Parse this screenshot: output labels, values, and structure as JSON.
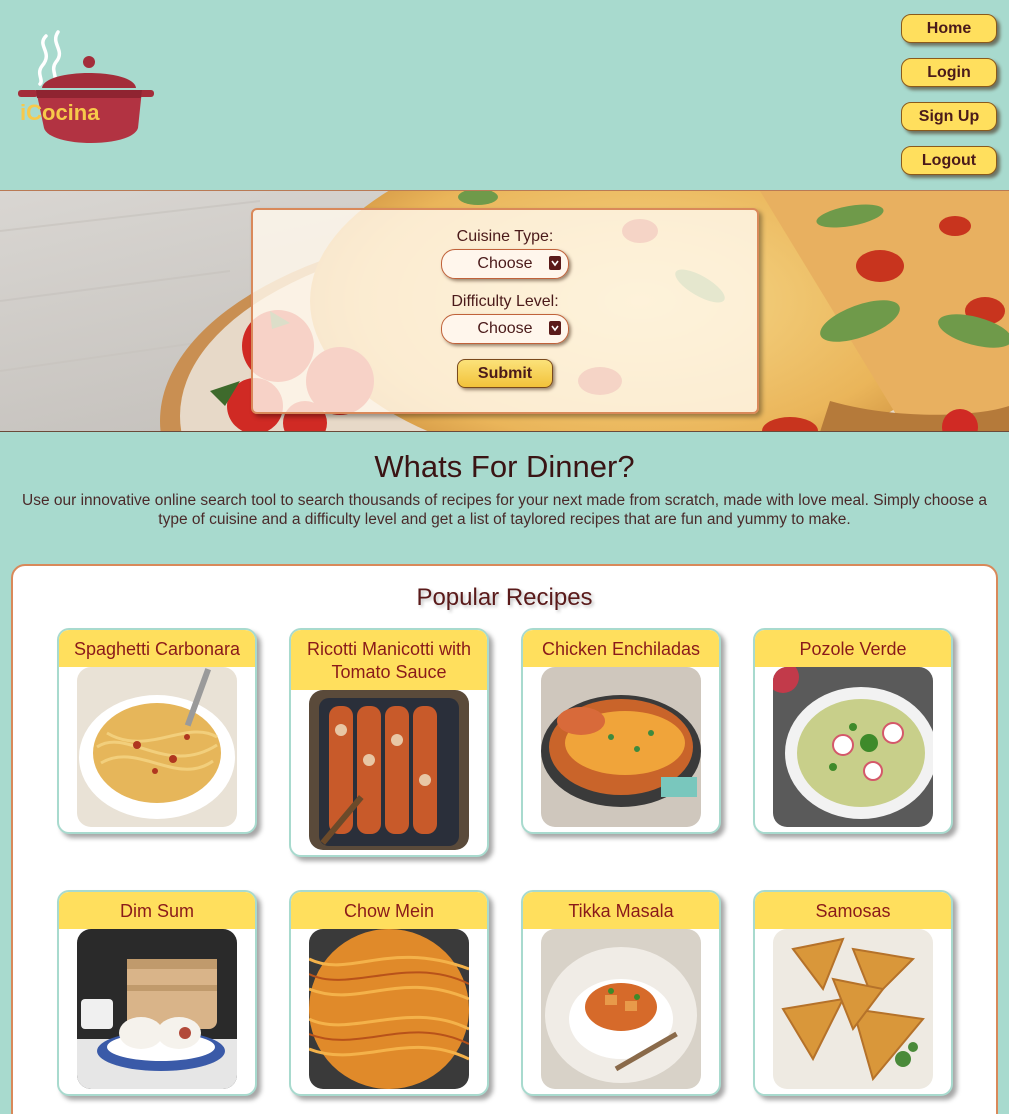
{
  "brand": {
    "name": "iCocina"
  },
  "nav": {
    "home": "Home",
    "login": "Login",
    "signup": "Sign Up",
    "logout": "Logout"
  },
  "search": {
    "cuisine_label": "Cuisine Type:",
    "cuisine_value": "Choose",
    "difficulty_label": "Difficulty Level:",
    "difficulty_value": "Choose",
    "submit_label": "Submit"
  },
  "intro": {
    "title": "Whats For Dinner?",
    "text": "Use our innovative online search tool to search thousands of recipes for your next made from scratch, made with love meal. Simply choose a type of cuisine and a difficulty level and get a list of taylored recipes that are fun and yummy to make."
  },
  "popular": {
    "title": "Popular Recipes",
    "recipes": [
      {
        "title": "Spaghetti Carbonara"
      },
      {
        "title": "Ricotti Manicotti with Tomato Sauce"
      },
      {
        "title": "Chicken Enchiladas"
      },
      {
        "title": "Pozole Verde"
      },
      {
        "title": "Dim Sum"
      },
      {
        "title": "Chow Mein"
      },
      {
        "title": "Tikka Masala"
      },
      {
        "title": "Samosas"
      }
    ]
  },
  "colors": {
    "background": "#a8dace",
    "accent": "#ffdf5d",
    "border": "#d9895a",
    "text": "#4a1a1a"
  }
}
